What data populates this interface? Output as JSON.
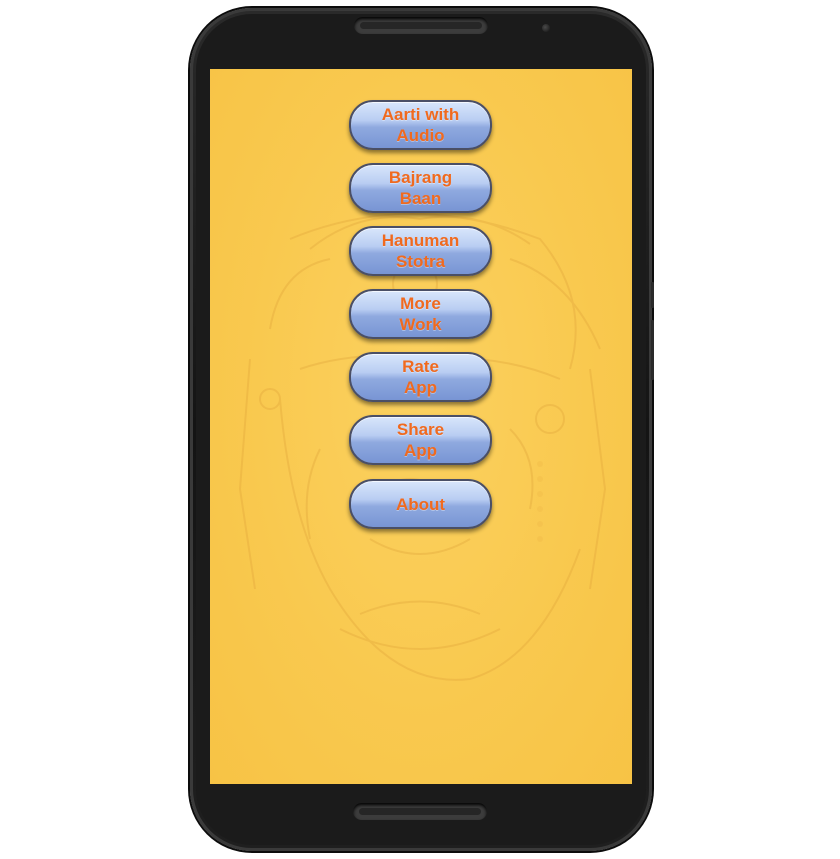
{
  "screen": {
    "background_color": "#f9c94f",
    "background_image": "faint-deity-sketch-watermark",
    "buttons": [
      {
        "id": "aarti",
        "label": "Aarti with\nAudio"
      },
      {
        "id": "bajrang",
        "label": "Bajrang\nBaan"
      },
      {
        "id": "stotra",
        "label": "Hanuman\nStotra"
      },
      {
        "id": "more",
        "label": "More\nWork"
      },
      {
        "id": "rate",
        "label": "Rate\nApp"
      },
      {
        "id": "share",
        "label": "Share\nApp"
      },
      {
        "id": "about",
        "label": "About"
      }
    ]
  },
  "colors": {
    "button_text": "#f06a1f",
    "button_fill": "#9fb7e6",
    "device_frame": "#1b1b1b"
  }
}
